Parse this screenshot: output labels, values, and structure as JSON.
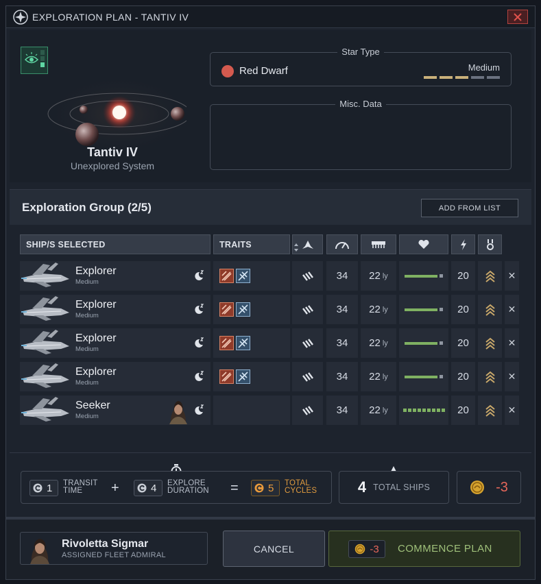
{
  "window": {
    "title": "EXPLORATION PLAN - TANTIV IV"
  },
  "system": {
    "name": "Tantiv IV",
    "status": "Unexplored System"
  },
  "star_type": {
    "legend": "Star Type",
    "name": "Red Dwarf",
    "size": "Medium",
    "size_level": 3,
    "size_max": 5,
    "color": "#d45a4f"
  },
  "misc": {
    "legend": "Misc. Data"
  },
  "group": {
    "title": "Exploration Group (2/5)",
    "add_button": "ADD FROM LIST"
  },
  "table": {
    "headers": {
      "ships": "SHIP/S SELECTED",
      "traits": "TRAITS"
    },
    "header_icons": [
      "fleet-icon",
      "speed-icon",
      "range-icon",
      "health-icon",
      "power-icon",
      "rank-icon"
    ],
    "rows": [
      {
        "name": "Explorer",
        "class": "Medium",
        "speed": "34",
        "range": "22",
        "range_unit": "ly",
        "hp_fraction": 0.92,
        "power": "20"
      },
      {
        "name": "Explorer",
        "class": "Medium",
        "speed": "34",
        "range": "22",
        "range_unit": "ly",
        "hp_fraction": 0.92,
        "power": "20"
      },
      {
        "name": "Explorer",
        "class": "Medium",
        "speed": "34",
        "range": "22",
        "range_unit": "ly",
        "hp_fraction": 0.92,
        "power": "20"
      },
      {
        "name": "Explorer",
        "class": "Medium",
        "speed": "34",
        "range": "22",
        "range_unit": "ly",
        "hp_fraction": 0.92,
        "power": "20"
      },
      {
        "name": "Seeker",
        "class": "Medium",
        "speed": "34",
        "range": "22",
        "range_unit": "ly",
        "hp_fraction": 1.0,
        "power": "20"
      }
    ]
  },
  "summary": {
    "transit_value": "1",
    "transit_label_1": "TRANSIT",
    "transit_label_2": "TIME",
    "plus": "+",
    "explore_value": "4",
    "explore_label_1": "EXPLORE",
    "explore_label_2": "DURATION",
    "equals": "=",
    "total_value": "5",
    "total_label_1": "TOTAL",
    "total_label_2": "CYCLES",
    "ships_count": "4",
    "ships_label": "TOTAL SHIPS",
    "credits": "-3"
  },
  "footer": {
    "admiral_name": "Rivoletta Sigmar",
    "admiral_role": "ASSIGNED FLEET ADMIRAL",
    "cancel": "CANCEL",
    "commence_cost": "-3",
    "commence": "COMMENCE PLAN"
  },
  "colors": {
    "accent_green": "#9fc07a",
    "accent_orange": "#e09b3f",
    "danger": "#e7675a",
    "hp": "#7fb162"
  }
}
